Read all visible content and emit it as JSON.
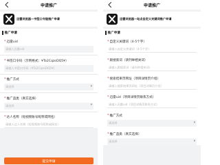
{
  "left_screen": {
    "title": "申请推广",
    "app_subtitle": "迅雷浏览器—书签口令链推广申请",
    "section_title": "推广申请",
    "fields": [
      {
        "label": "迅雷uid",
        "placeholder": "请输入迅雷uid",
        "required": true,
        "type": "text"
      },
      {
        "label": "书签口令码（示例格式：¥Ta2CqzoDQ5¥）",
        "placeholder": "请输入书签口令码（¥Ta2CqzoDQ5¥）",
        "required": true,
        "type": "text"
      },
      {
        "label": "推广方式",
        "placeholder": "请选择",
        "required": true,
        "type": "select"
      },
      {
        "label": "推广品类（真实选择）",
        "placeholder": "请选择",
        "required": true,
        "type": "select"
      },
      {
        "label": "达人名称（短视频账号昵称或网名）",
        "placeholder": "请输入达人名称（短视频账号昵称或网名）",
        "required": true,
        "type": "text"
      }
    ],
    "submit_label": "提交申请"
  },
  "right_screen": {
    "title": "申请推广",
    "app_subtitle": "迅雷浏览器—站点自定义关键词推广申请",
    "section_title": "推广申请",
    "fields": [
      {
        "label": "自定义关键词（4-5个字）",
        "placeholder": "请输入自定义关键词（4-5个字）",
        "required": true,
        "type": "text"
      },
      {
        "label": "跟搜索词（请列举相关词）",
        "placeholder": "请输入跟搜索词（请列举相关词）",
        "required": true,
        "type": "text"
      },
      {
        "label": "搜索结果页网址（项目详情页介绍）",
        "placeholder": "请输入搜索结果页网址（项目详情页介绍）",
        "required": true,
        "type": "text"
      },
      {
        "label": "迅雷uid（项目详情页联系方式）",
        "placeholder": "请输入迅雷uid（项目详情页联系方式）",
        "required": true,
        "type": "text"
      },
      {
        "label": "推广方式",
        "placeholder": "请选择",
        "required": true,
        "type": "select"
      },
      {
        "label": "推广品类（真实选择）",
        "placeholder": "请选择",
        "required": true,
        "type": "select"
      }
    ]
  }
}
